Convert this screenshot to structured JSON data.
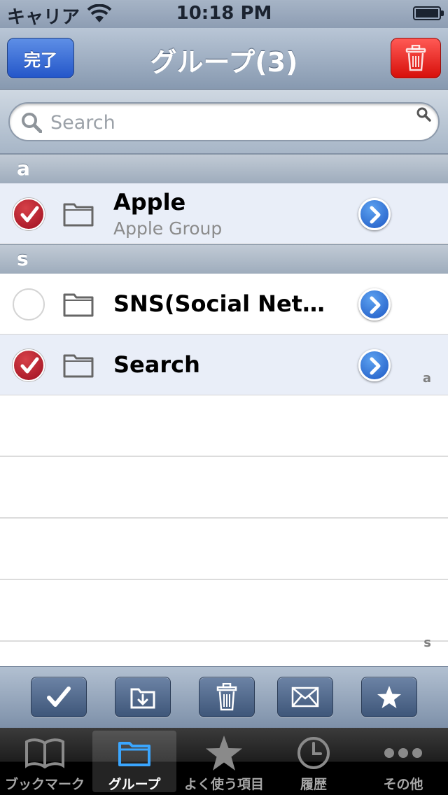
{
  "status_bar": {
    "carrier": "キャリア",
    "time": "10:18 PM"
  },
  "nav": {
    "title": "グループ(3)",
    "done_label": "完了"
  },
  "search": {
    "placeholder": "Search"
  },
  "sections": [
    {
      "header": "a",
      "rows": [
        {
          "title": "Apple",
          "subtitle": "Apple Group",
          "checked": true
        }
      ]
    },
    {
      "header": "s",
      "rows": [
        {
          "title": "SNS(Social Net…",
          "checked": false
        },
        {
          "title": "Search",
          "checked": true
        }
      ]
    }
  ],
  "index": [
    "a",
    "s"
  ],
  "toolbar": {
    "icons": [
      "checkmark-icon",
      "move-folder-icon",
      "trash-icon",
      "mail-icon",
      "star-icon"
    ]
  },
  "tabs": [
    {
      "label": "ブックマーク",
      "icon": "book-icon",
      "active": false
    },
    {
      "label": "グループ",
      "icon": "folder-icon",
      "active": true
    },
    {
      "label": "よく使う項目",
      "icon": "star-icon",
      "active": false
    },
    {
      "label": "履歴",
      "icon": "clock-icon",
      "active": false
    },
    {
      "label": "その他",
      "icon": "more-icon",
      "active": false
    }
  ],
  "colors": {
    "accent_blue": "#2456c9",
    "delete_red": "#d70f0a",
    "check_red": "#9e1020"
  }
}
